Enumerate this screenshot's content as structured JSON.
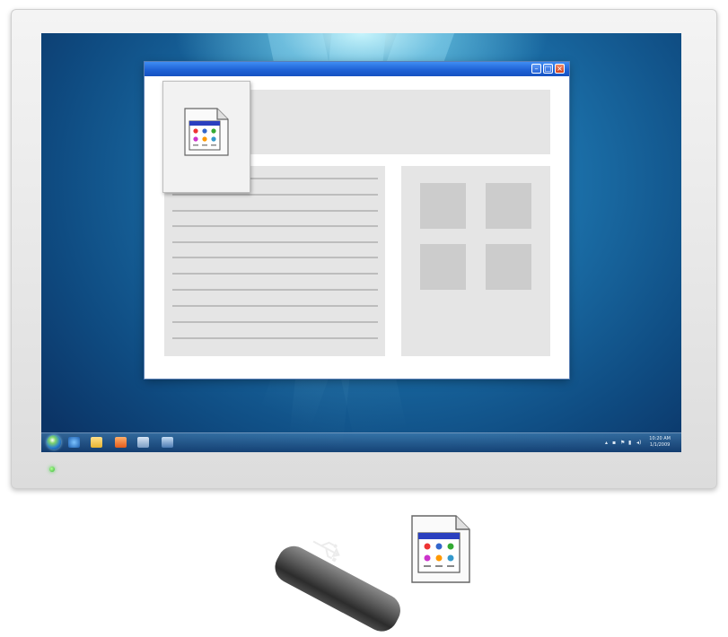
{
  "desktop": {
    "os_style": "windows-7",
    "taskbar": {
      "start_button": "windows-orb-icon",
      "pinned_icons": [
        "ie-icon",
        "folder-icon",
        "media-player-icon",
        "app-icon",
        "computer-icon"
      ],
      "tray_icons": [
        "up-arrow-icon",
        "network-icon",
        "flag-icon",
        "battery-icon",
        "volume-icon"
      ],
      "clock": {
        "time": "10:20 AM",
        "date": "1/1/2009"
      }
    },
    "window": {
      "buttons": [
        "minimize-button",
        "maximize-button",
        "close-button"
      ],
      "colors": {
        "titlebar": "#1f63d6",
        "close": "#d2421e",
        "placeholder": "#e5e5e5"
      }
    }
  },
  "monitor": {
    "power_led_color": "#2fb52f"
  },
  "accessories": {
    "usb_drive": "usb-flash-drive-icon",
    "file_icon": "application-file-icon"
  }
}
